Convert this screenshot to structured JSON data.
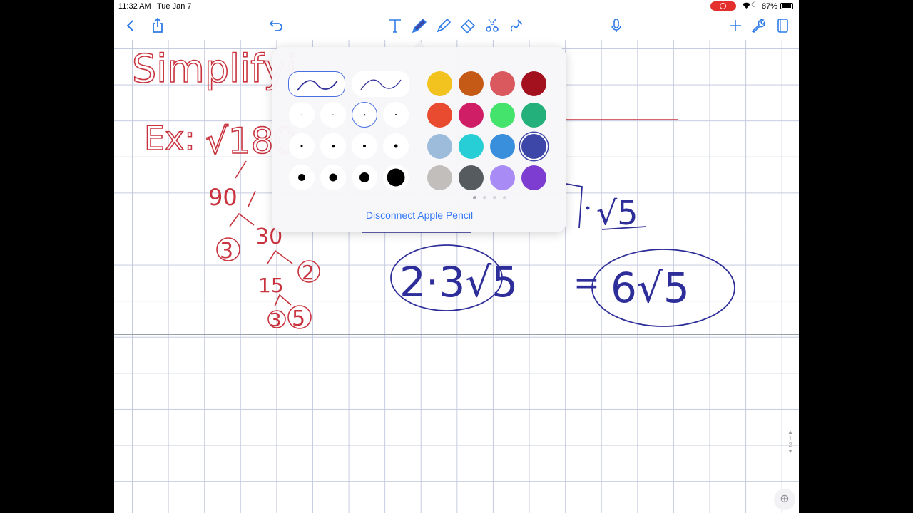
{
  "status_bar": {
    "time": "11:32 AM",
    "date": "Tue Jan 7",
    "battery": "87%"
  },
  "toolbar": {
    "left": [
      "back-icon",
      "share-icon",
      "undo-icon"
    ],
    "tools": [
      "text-tool-icon",
      "pen-tool-icon",
      "highlighter-tool-icon",
      "eraser-tool-icon",
      "lasso-tool-icon",
      "shapes-tool-icon"
    ],
    "right": [
      "microphone-icon",
      "add-icon",
      "wrench-icon",
      "page-view-icon"
    ],
    "accent": "#2f7be6"
  },
  "note": {
    "title": "Simplifyi",
    "example_label": "Ex:",
    "expression": "√180",
    "factor_tree": [
      "90",
      "3",
      "30",
      "15",
      "2",
      "3",
      "5"
    ],
    "work": [
      "√5",
      "2·3√5",
      "=",
      "6√5"
    ],
    "ink_red": "#c8333e",
    "ink_blue": "#2e2e9a"
  },
  "pen_popover": {
    "stroke_styles": [
      "fountain-pen",
      "ballpoint-pen"
    ],
    "selected_stroke": 0,
    "sizes": [
      1,
      1.2,
      1.5,
      2,
      3,
      3.5,
      4,
      5,
      10,
      11,
      14,
      25
    ],
    "selected_size": 2,
    "colors": [
      "#f2c21e",
      "#c45a15",
      "#d9595e",
      "#a3111f",
      "#e84b30",
      "#cf1d66",
      "#44e36c",
      "#24b07a",
      "#9dbbdb",
      "#28ced6",
      "#3a8fdc",
      "#3d47a8",
      "#c2bebb",
      "#555b5e",
      "#a98bf5",
      "#7d3dd1"
    ],
    "selected_color": 11,
    "disconnect_label": "Disconnect Apple Pencil"
  },
  "page_indicator": {
    "current": "1",
    "total": "2"
  }
}
